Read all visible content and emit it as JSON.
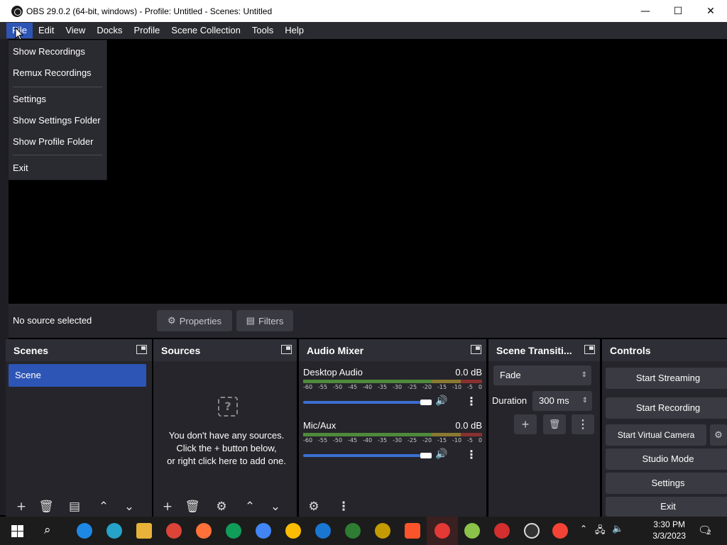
{
  "window": {
    "title": "OBS 29.0.2 (64-bit, windows) - Profile: Untitled - Scenes: Untitled",
    "minimize": "—",
    "maximize": "☐",
    "close": "✕"
  },
  "menubar": {
    "items": [
      "File",
      "Edit",
      "View",
      "Docks",
      "Profile",
      "Scene Collection",
      "Tools",
      "Help"
    ]
  },
  "file_menu": {
    "items": [
      "Show Recordings",
      "Remux Recordings",
      "Settings",
      "Show Settings Folder",
      "Show Profile Folder",
      "Exit"
    ]
  },
  "source_toolbar": {
    "no_source": "No source selected",
    "properties": "Properties",
    "filters": "Filters"
  },
  "scenes": {
    "title": "Scenes",
    "items": [
      "Scene"
    ]
  },
  "sources": {
    "title": "Sources",
    "empty_line1": "You don't have any sources.",
    "empty_line2": "Click the + button below,",
    "empty_line3": "or right click here to add one."
  },
  "mixer": {
    "title": "Audio Mixer",
    "channels": [
      {
        "name": "Desktop Audio",
        "db": "0.0 dB"
      },
      {
        "name": "Mic/Aux",
        "db": "0.0 dB"
      }
    ],
    "ticks": [
      "-60",
      "-55",
      "-50",
      "-45",
      "-40",
      "-35",
      "-30",
      "-25",
      "-20",
      "-15",
      "-10",
      "-5",
      "0"
    ]
  },
  "transitions": {
    "title": "Scene Transiti...",
    "selected": "Fade",
    "duration_label": "Duration",
    "duration_value": "300 ms"
  },
  "controls": {
    "title": "Controls",
    "start_streaming": "Start Streaming",
    "start_recording": "Start Recording",
    "start_virtual_camera": "Start Virtual Camera",
    "studio_mode": "Studio Mode",
    "settings": "Settings",
    "exit": "Exit"
  },
  "taskbar": {
    "time": "3:30 PM",
    "date": "3/3/2023",
    "notification_count": "2"
  },
  "colors": {
    "accent": "#2d55b5",
    "panel": "#25252b",
    "header": "#2e2e36",
    "button": "#3a3a42"
  }
}
